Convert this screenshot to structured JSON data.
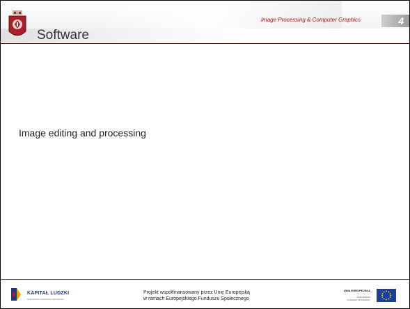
{
  "header": {
    "course_title": "Image Processing & Computer Graphics",
    "page_number": "4",
    "slide_title": "Software"
  },
  "content": {
    "body_text": "Image editing and processing"
  },
  "footer": {
    "program_title": "KAPITAŁ LUDZKI",
    "program_subtitle": "NARODOWA STRATEGIA SPÓJNOŚCI",
    "project_line1": "Projekt współfinansowany przez Unię Europejską",
    "project_line2": "w ramach Europejskiego Funduszu Społecznego",
    "eu_title": "UNIA EUROPEJSKA",
    "eu_sub_line1": "EUROPEJSKI",
    "eu_sub_line2": "FUNDUSZ SPOŁECZNY"
  },
  "colors": {
    "accent_red": "#b0121b",
    "program_blue": "#1f3a7a",
    "eu_blue": "#1b3f9a",
    "eu_star": "#ffdd00"
  },
  "icons": {
    "crest": "university-crest-icon",
    "kl_logo": "kapital-ludzki-logo-icon",
    "eu_flag": "eu-flag-icon"
  }
}
